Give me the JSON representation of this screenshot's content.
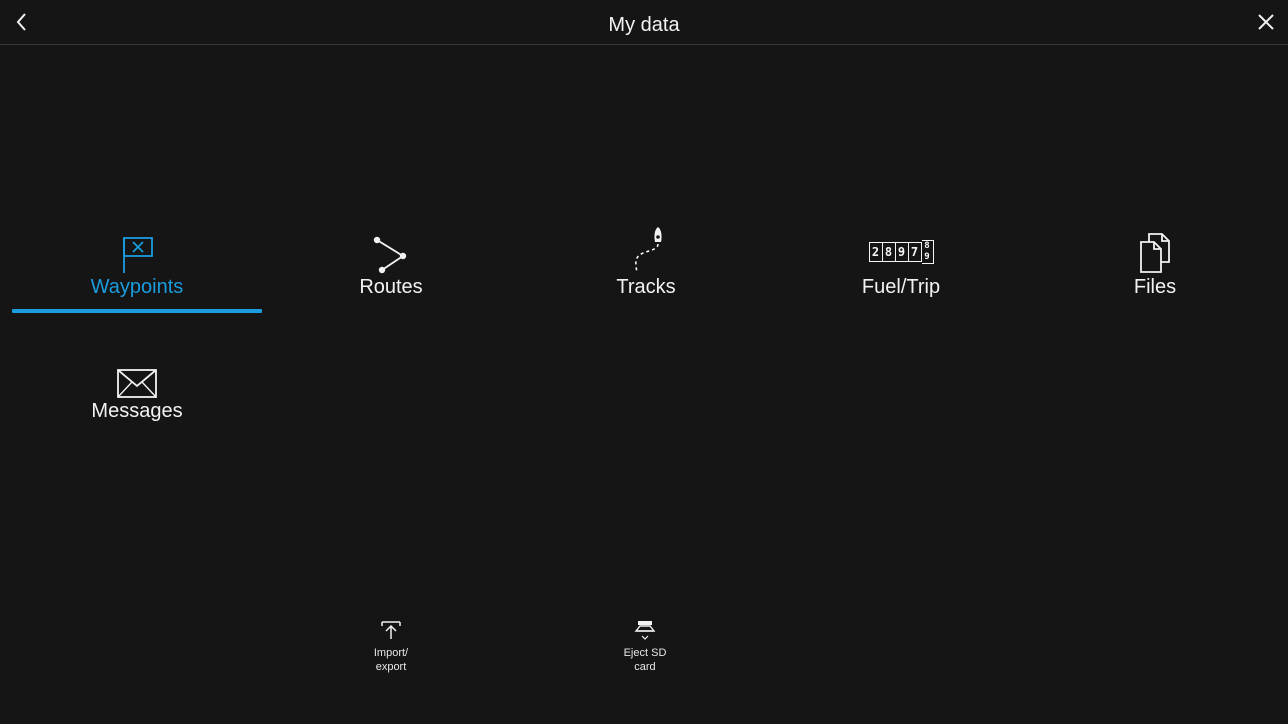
{
  "header": {
    "title": "My data",
    "back_icon": "chevron-left-icon",
    "close_icon": "close-icon"
  },
  "tiles": [
    {
      "label": "Waypoints",
      "icon": "waypoint-flag-icon",
      "selected": true
    },
    {
      "label": "Routes",
      "icon": "route-icon",
      "selected": false
    },
    {
      "label": "Tracks",
      "icon": "track-boat-icon",
      "selected": false
    },
    {
      "label": "Fuel/Trip",
      "icon": "trip-counter-icon",
      "selected": false,
      "counter_digits": [
        "2",
        "8",
        "9",
        "7"
      ],
      "counter_roll": [
        "8",
        "9"
      ]
    },
    {
      "label": "Files",
      "icon": "files-icon",
      "selected": false
    },
    {
      "label": "Messages",
      "icon": "envelope-icon",
      "selected": false
    }
  ],
  "actions": [
    {
      "label": "Import/\nexport",
      "icon": "upload-icon"
    },
    {
      "label": "Eject SD\ncard",
      "icon": "eject-sd-icon"
    }
  ],
  "colors": {
    "background": "#151515",
    "accent": "#1a9cde",
    "text": "#f2f2f2"
  }
}
